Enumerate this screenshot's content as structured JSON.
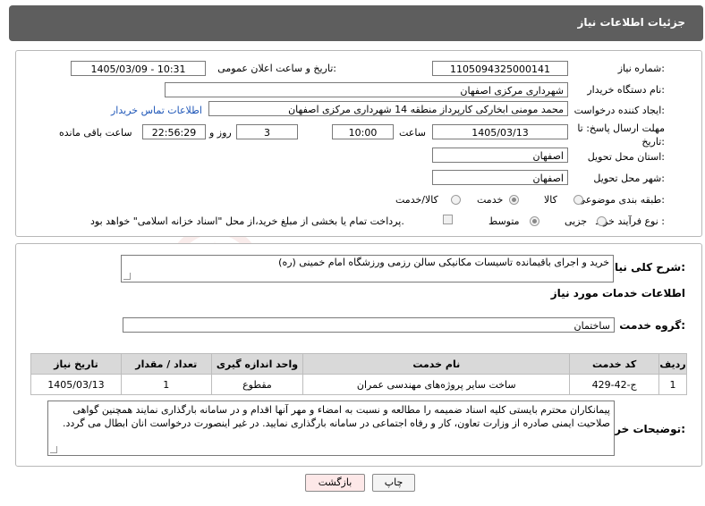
{
  "header": {
    "title": "جزئیات اطلاعات نیاز"
  },
  "fields": {
    "need_number_label": "شماره نیاز:",
    "need_number": "1105094325000141",
    "announce_label": "تاریخ و ساعت اعلان عمومی:",
    "announce_value": "1405/03/09 - 10:31",
    "buyer_org_label": "نام دستگاه خریدار:",
    "buyer_org": "شهرداری مرکزی اصفهان",
    "creator_label": "ایجاد کننده درخواست:",
    "creator": "محمد مومنی ابخارکی کارپرداز منطقه 14 شهرداری مرکزی اصفهان",
    "buyer_contact_link": "اطلاعات تماس خریدار",
    "deadline_label_1": "مهلت ارسال پاسخ: تا",
    "deadline_label_2": "تاریخ:",
    "deadline_date": "1405/03/13",
    "time_label": "ساعت",
    "deadline_time": "10:00",
    "days_value": "3",
    "days_label": "روز و",
    "remaining_time": "22:56:29",
    "remaining_label": "ساعت باقی مانده",
    "province_label": "استان محل تحویل:",
    "province": "اصفهان",
    "city_label": "شهر محل تحویل:",
    "city": "اصفهان",
    "category_label": "طبقه بندی موضوعی:",
    "category_options": [
      "کالا",
      "خدمت",
      "کالا/خدمت"
    ],
    "category_selected": "خدمت",
    "process_label": "نوع فرآیند خرید :",
    "process_options": [
      "جزیی",
      "متوسط"
    ],
    "process_selected": "متوسط",
    "payment_note": "پرداخت تمام یا بخشی از مبلغ خرید،از محل \"اسناد خزانه اسلامی\" خواهد بود."
  },
  "summary": {
    "label": "شرح کلی نیاز:",
    "text": "خرید و اجرای باقیمانده تاسیسات مکانیکی سالن رزمی ورزشگاه امام خمینی (ره)"
  },
  "services": {
    "section_title": "اطلاعات خدمات مورد نیاز",
    "group_label": "گروه خدمت:",
    "group_value": "ساختمان",
    "columns": [
      "ردیف",
      "کد خدمت",
      "نام خدمت",
      "واحد اندازه گیری",
      "تعداد / مقدار",
      "تاریخ نیاز"
    ],
    "rows": [
      [
        "1",
        "ج-42-429",
        "ساخت سایر پروژه‌های مهندسی عمران",
        "مقطوع",
        "1",
        "1405/03/13"
      ]
    ]
  },
  "buyer_notes": {
    "label": "توضیحات خریدار:",
    "text": "پیمانکاران محترم بایستی کلیه اسناد ضمیمه را مطالعه و نسبت به امضاء و مهر آنها اقدام و در سامانه بارگذاری نمایند همچنین گواهی صلاحیت ایمنی صادره از وزارت تعاون، کار و رفاه اجتماعی در سامانه بارگذاری نمایید. در غیر اینصورت درخواست انان ابطال می گردد."
  },
  "buttons": {
    "print": "چاپ",
    "back": "بازگشت"
  },
  "watermark": "AriaTender.neT",
  "colors": {
    "title_bg": "#5e5e5e",
    "link": "#1f57b8",
    "table_header": "#d9d9d9",
    "watermark": "#c0392b"
  }
}
